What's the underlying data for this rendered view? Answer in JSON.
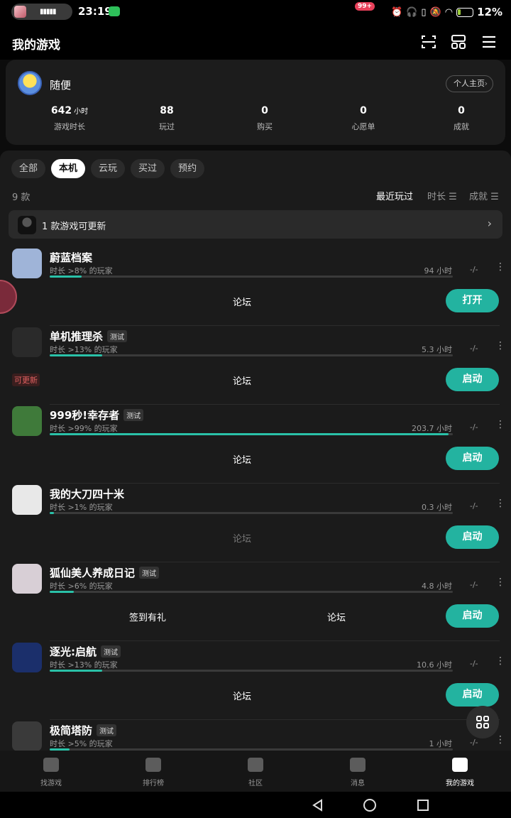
{
  "statusbar": {
    "time": "23:19",
    "battery": "12%"
  },
  "header": {
    "title": "我的游戏"
  },
  "profile": {
    "username": "随便",
    "homepage_label": "个人主页",
    "stats": [
      {
        "value": "642",
        "unit": "小时",
        "label": "游戏时长"
      },
      {
        "value": "88",
        "unit": "",
        "label": "玩过"
      },
      {
        "value": "0",
        "unit": "",
        "label": "购买"
      },
      {
        "value": "0",
        "unit": "",
        "label": "心愿单"
      },
      {
        "value": "0",
        "unit": "",
        "label": "成就"
      }
    ]
  },
  "tabs": [
    {
      "label": "全部",
      "active": false
    },
    {
      "label": "本机",
      "active": true
    },
    {
      "label": "云玩",
      "active": false
    },
    {
      "label": "买过",
      "active": false
    },
    {
      "label": "预约",
      "active": false
    }
  ],
  "list": {
    "count": "9 款",
    "sort": {
      "recent": "最近玩过",
      "duration": "时长",
      "achievement": "成就"
    },
    "update_banner": "1 款游戏可更新"
  },
  "games": [
    {
      "name": "蔚蓝档案",
      "tag": "",
      "sub": "时长 >8% 的玩家",
      "hours": "94 小时",
      "progress": 0.08,
      "achievement": "-/-",
      "actions": [
        "论坛"
      ],
      "button": "打开",
      "update": "",
      "icon_color": "#9fb4d8"
    },
    {
      "name": "单机推理杀",
      "tag": "测试",
      "sub": "时长 >13% 的玩家",
      "hours": "5.3 小时",
      "progress": 0.13,
      "achievement": "-/-",
      "actions": [
        "论坛"
      ],
      "button": "启动",
      "update": "可更新",
      "icon_color": "#2a2a2a"
    },
    {
      "name": "999秒!幸存者",
      "tag": "测试",
      "sub": "时长 >99% 的玩家",
      "hours": "203.7 小时",
      "progress": 0.99,
      "achievement": "-/-",
      "actions": [
        "论坛"
      ],
      "button": "启动",
      "update": "",
      "icon_color": "#3f7a3a"
    },
    {
      "name": "我的大刀四十米",
      "tag": "",
      "sub": "时长 >1% 的玩家",
      "hours": "0.3 小时",
      "progress": 0.01,
      "achievement": "-/-",
      "actions": [
        "论坛"
      ],
      "button": "启动",
      "update": "",
      "icon_color": "#e8e8e8"
    },
    {
      "name": "狐仙美人养成日记",
      "tag": "测试",
      "sub": "时长 >6% 的玩家",
      "hours": "4.8 小时",
      "progress": 0.06,
      "achievement": "-/-",
      "actions": [
        "签到有礼",
        "论坛"
      ],
      "button": "启动",
      "update": "",
      "icon_color": "#d8cfd6"
    },
    {
      "name": "逐光:启航",
      "tag": "测试",
      "sub": "时长 >13% 的玩家",
      "hours": "10.6 小时",
      "progress": 0.13,
      "achievement": "-/-",
      "actions": [
        "论坛"
      ],
      "button": "启动",
      "update": "",
      "icon_color": "#1b2f6b"
    },
    {
      "name": "极简塔防",
      "tag": "测试",
      "sub": "时长 >5% 的玩家",
      "hours": "1 小时",
      "progress": 0.05,
      "achievement": "-/-",
      "actions": [],
      "button": "",
      "update": "",
      "icon_color": "#3a3a3a"
    }
  ],
  "bottomnav": [
    {
      "label": "找游戏",
      "active": false
    },
    {
      "label": "排行榜",
      "active": false
    },
    {
      "label": "社区",
      "active": false
    },
    {
      "label": "消息",
      "active": false
    },
    {
      "label": "我的游戏",
      "active": true
    }
  ],
  "messages_badge": "99+",
  "colors": {
    "accent": "#23b3a0",
    "progress": "#2ac1a8",
    "update_red": "#e06060"
  }
}
